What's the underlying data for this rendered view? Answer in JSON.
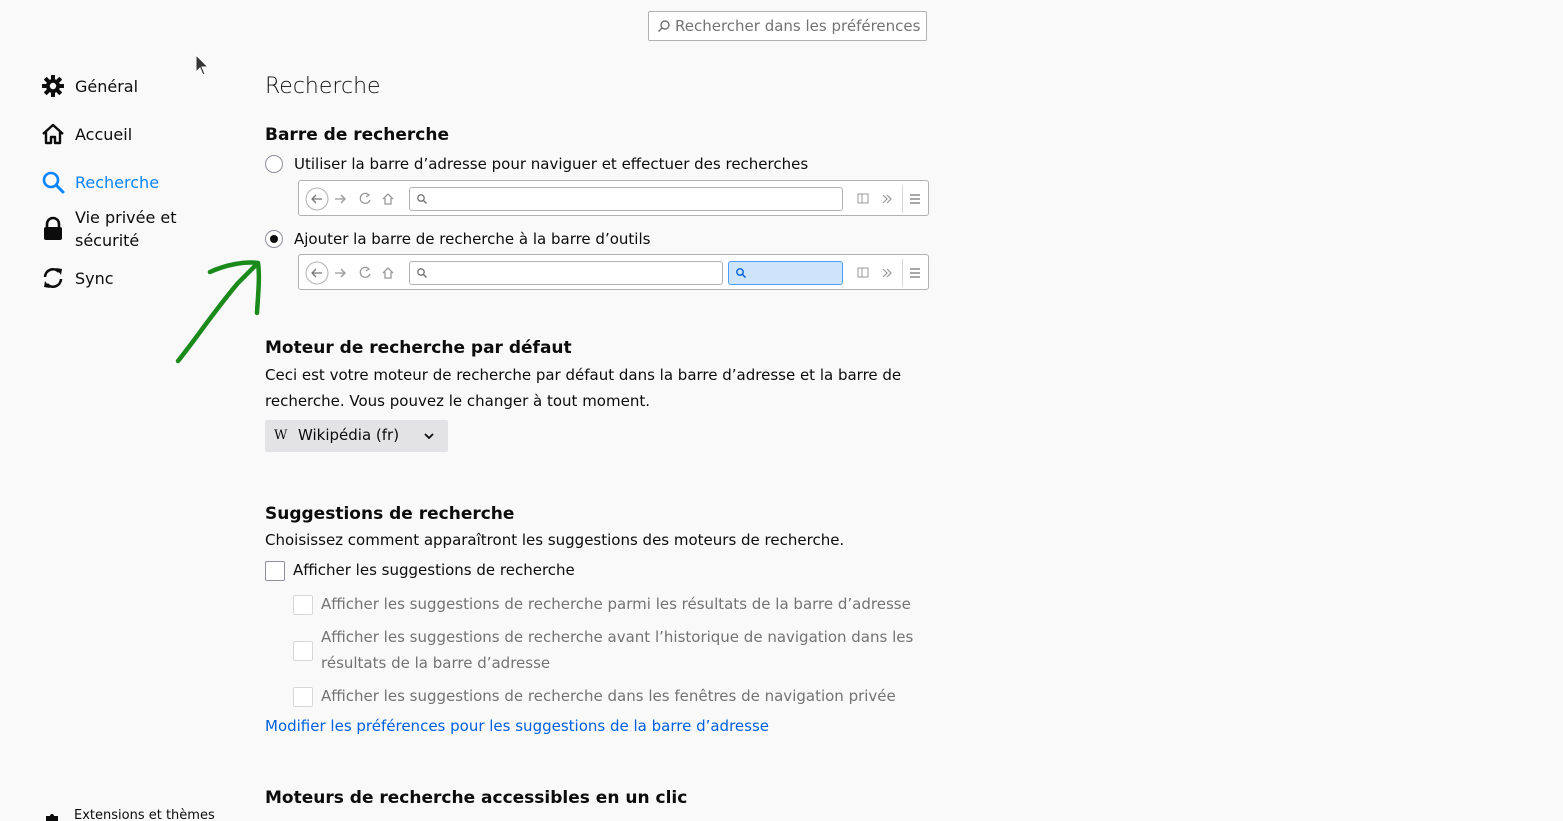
{
  "search": {
    "placeholder": "Rechercher dans les préférences"
  },
  "sidebar": {
    "items": [
      {
        "label": "Général",
        "icon": "gear-icon"
      },
      {
        "label": "Accueil",
        "icon": "home-icon"
      },
      {
        "label": "Recherche",
        "icon": "search-icon",
        "active": true
      },
      {
        "label": "Vie privée et sécurité",
        "label_line1": "Vie privée et",
        "label_line2": "sécurité",
        "icon": "lock-icon"
      },
      {
        "label": "Sync",
        "icon": "sync-icon"
      }
    ],
    "footer": {
      "label": "Extensions et thèmes",
      "icon": "puzzle-icon"
    }
  },
  "main": {
    "title": "Recherche",
    "search_bar": {
      "heading": "Barre de recherche",
      "option_urlbar": "Utiliser la barre d’adresse pour naviguer et effectuer des recherches",
      "option_toolbar": "Ajouter la barre de recherche à la barre d’outils",
      "selected": "option_toolbar"
    },
    "default_engine": {
      "heading": "Moteur de recherche par défaut",
      "description_line1": "Ceci est votre moteur de recherche par défaut dans la barre d’adresse et la barre de",
      "description_line2": "recherche. Vous pouvez le changer à tout moment.",
      "selected": "Wikipédia (fr)",
      "icon_letter": "W"
    },
    "suggestions": {
      "heading": "Suggestions de recherche",
      "description": "Choisissez comment apparaîtront les suggestions des moteurs de recherche.",
      "show_label": "Afficher les suggestions de recherche",
      "sub_urlbar": "Afficher les suggestions de recherche parmi les résultats de la barre d’adresse",
      "sub_before_history_line1": "Afficher les suggestions de recherche avant l’historique de navigation dans les",
      "sub_before_history_line2": "résultats de la barre d’adresse",
      "sub_private": "Afficher les suggestions de recherche dans les fenêtres de navigation privée",
      "link": "Modifier les préférences pour les suggestions de la barre d’adresse"
    },
    "one_click": {
      "heading": "Moteurs de recherche accessibles en un clic"
    }
  },
  "colors": {
    "accent": "#0a84ff",
    "link": "#0060df",
    "annotation": "#1a8a1a"
  }
}
